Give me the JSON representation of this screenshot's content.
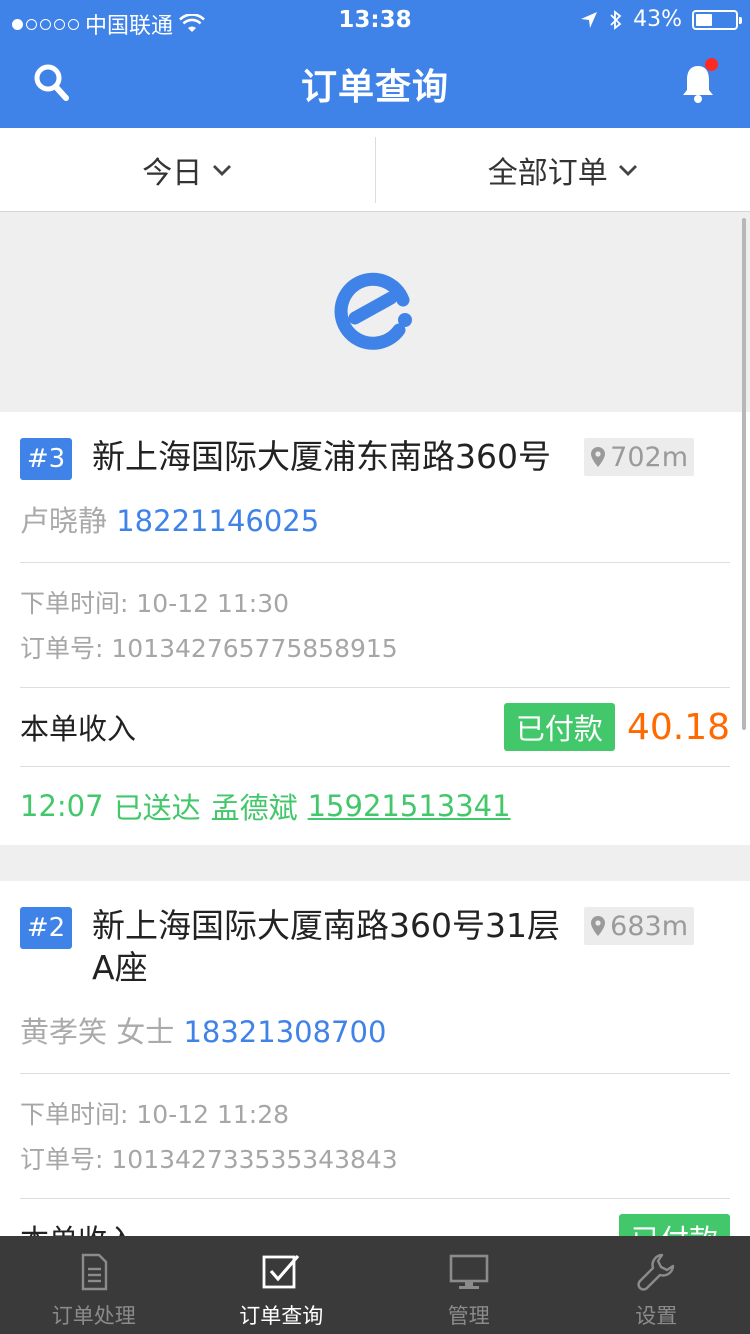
{
  "status_bar": {
    "carrier": "中国联通",
    "time": "13:38",
    "battery": "43%",
    "battery_level": 0.43
  },
  "nav": {
    "title": "订单查询"
  },
  "filters": {
    "date_label": "今日",
    "order_type_label": "全部订单"
  },
  "orders": [
    {
      "number": "#3",
      "address": "新上海国际大厦浦东南路360号",
      "distance": "702m",
      "customer": "卢晓静",
      "phone": "18221146025",
      "order_time_label": "下单时间:",
      "order_time": "10-12 11:30",
      "order_id_label": "订单号:",
      "order_id": "101342765775858915",
      "income_label": "本单收入",
      "payment_status": "已付款",
      "amount": "40.18",
      "delivery_time": "12:07",
      "delivery_status": "已送达",
      "courier": "孟德斌",
      "courier_phone": "15921513341"
    },
    {
      "number": "#2",
      "address": "新上海国际大厦南路360号31层A座",
      "distance": "683m",
      "customer": "黄孝笑 女士",
      "phone": "18321308700",
      "order_time_label": "下单时间:",
      "order_time": "10-12 11:28",
      "order_id_label": "订单号:",
      "order_id": "101342733535343843",
      "income_label": "本单收入",
      "payment_status": "已付款"
    }
  ],
  "tabs": [
    {
      "label": "订单处理",
      "icon": "document-list-icon",
      "active": false
    },
    {
      "label": "订单查询",
      "icon": "checkbox-icon",
      "active": true
    },
    {
      "label": "管理",
      "icon": "monitor-icon",
      "active": false
    },
    {
      "label": "设置",
      "icon": "wrench-icon",
      "active": false
    }
  ],
  "colors": {
    "primary": "#3f82e8",
    "paid": "#43c76b",
    "amount": "#ff6a00",
    "tabbar": "#3a3a3a",
    "badge": "#ff2a1f"
  }
}
